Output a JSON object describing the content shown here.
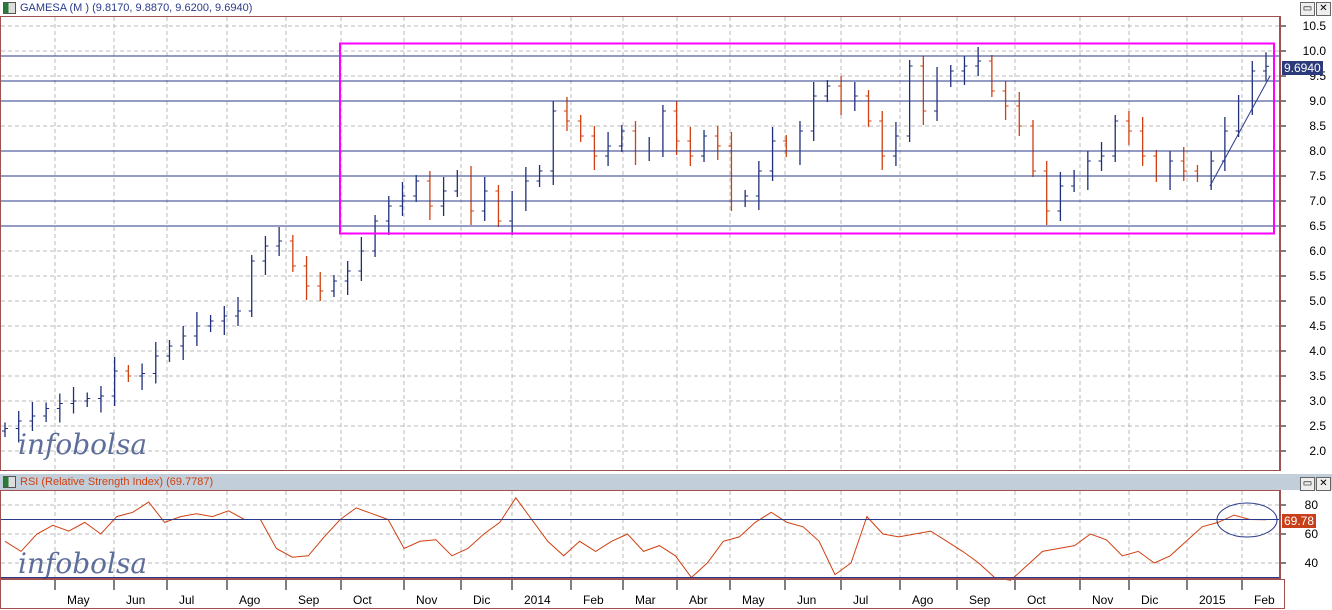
{
  "main_panel": {
    "title": "GAMESA (M ) (9.8170, 9.8870, 9.6200, 9.6940)",
    "last_value": "9.6940",
    "watermark": "infobolsa"
  },
  "rsi_panel": {
    "title": "RSI (Relative Strength Index) (69.7787)",
    "last_value": "69.78",
    "watermark": "infobolsa"
  },
  "colors": {
    "up": "#1f2f7a",
    "down": "#d04010",
    "rect": "#ff00ff",
    "hline": "#2a3a8a",
    "rsi": "#d04010",
    "frame": "#a05050"
  },
  "chart_data": [
    {
      "type": "bar",
      "subtype": "ohlc",
      "title": "GAMESA (M )",
      "ylim": [
        2.0,
        10.5
      ],
      "yticks": [
        "10.5",
        "10.0",
        "9.5",
        "9.0",
        "8.5",
        "8.0",
        "7.5",
        "7.0",
        "6.5",
        "6.0",
        "5.5",
        "5.0",
        "4.5",
        "4.0",
        "3.5",
        "3.0",
        "2.5",
        "2.0"
      ],
      "x_labels": [
        "May",
        "Jun",
        "Jul",
        "Ago",
        "Sep",
        "Oct",
        "Nov",
        "Dic",
        "2014",
        "Feb",
        "Mar",
        "Abr",
        "May",
        "Jun",
        "Jul",
        "Ago",
        "Sep",
        "Oct",
        "Nov",
        "Dic",
        "2015",
        "Feb"
      ],
      "last": {
        "open": 9.817,
        "high": 9.887,
        "low": 9.62,
        "close": 9.694
      },
      "horizontal_levels": [
        9.9,
        9.4,
        9.0,
        8.0,
        7.5,
        7.0,
        6.5
      ],
      "channel_rectangle": {
        "price_top": 10.15,
        "price_bottom": 6.35,
        "from": "Oct 2013",
        "to": "Feb 2015"
      },
      "trendline": {
        "from": [
          "2015-01",
          7.3
        ],
        "to": [
          "2015-02",
          9.5
        ]
      },
      "weekly_close": [
        2.45,
        2.6,
        2.7,
        2.85,
        2.95,
        3.0,
        3.05,
        3.1,
        3.6,
        3.5,
        3.55,
        3.9,
        4.1,
        4.3,
        4.5,
        4.6,
        4.7,
        4.8,
        5.8,
        6.1,
        6.2,
        5.7,
        5.3,
        5.2,
        5.4,
        5.6,
        6.0,
        6.6,
        6.9,
        7.1,
        7.4,
        6.9,
        7.2,
        7.5,
        6.8,
        7.2,
        6.6,
        7.0,
        7.4,
        7.6,
        8.8,
        8.6,
        8.3,
        7.9,
        8.1,
        8.4,
        8.0,
        8.0,
        8.8,
        8.2,
        7.9,
        8.3,
        8.1,
        7.0,
        7.1,
        7.6,
        8.2,
        8.0,
        8.4,
        9.1,
        9.3,
        9.0,
        9.1,
        8.6,
        7.9,
        8.3,
        9.7,
        8.8,
        9.4,
        9.6,
        9.7,
        9.8,
        9.2,
        8.9,
        8.5,
        7.6,
        6.8,
        7.3,
        7.5,
        7.8,
        7.9,
        8.6,
        8.4,
        7.9,
        7.5,
        7.8,
        7.6,
        7.5,
        7.8,
        8.4,
        9.0,
        9.6,
        9.694
      ]
    },
    {
      "type": "line",
      "title": "RSI (Relative Strength Index)",
      "last": 69.7787,
      "ylim": [
        25,
        90
      ],
      "yticks": [
        "80",
        "60",
        "40"
      ],
      "levels": [
        70,
        30
      ],
      "series": [
        {
          "name": "RSI",
          "values": [
            55,
            48,
            60,
            66,
            62,
            68,
            60,
            72,
            75,
            82,
            68,
            72,
            74,
            72,
            76,
            70,
            70,
            50,
            44,
            45,
            58,
            70,
            78,
            74,
            70,
            50,
            55,
            56,
            45,
            50,
            60,
            68,
            85,
            70,
            55,
            45,
            55,
            48,
            55,
            60,
            48,
            52,
            45,
            30,
            40,
            55,
            58,
            68,
            75,
            68,
            65,
            55,
            32,
            40,
            72,
            60,
            58,
            60,
            62,
            55,
            48,
            40,
            30,
            28,
            38,
            48,
            50,
            52,
            60,
            56,
            45,
            48,
            40,
            45,
            55,
            65,
            68,
            73,
            70,
            69.78
          ]
        }
      ]
    }
  ]
}
